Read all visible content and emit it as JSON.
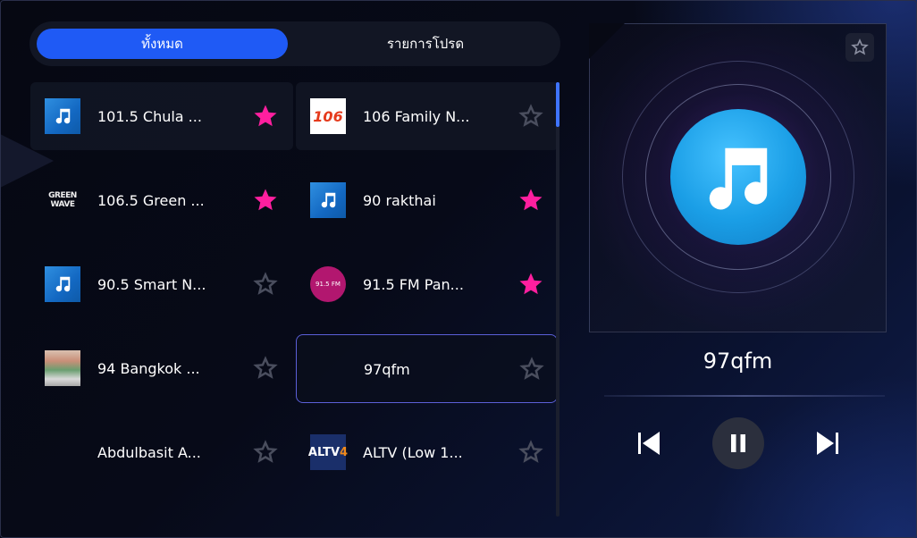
{
  "tabs": {
    "all_label": "ทั้งหมด",
    "favorites_label": "รายการโปรด"
  },
  "stations": [
    {
      "name": "101.5 Chula ...",
      "logo": "music-note",
      "favorite": true
    },
    {
      "name": "106 Family N...",
      "logo": "fm106",
      "favorite": false
    },
    {
      "name": "106.5 Green ...",
      "logo": "green-wave",
      "favorite": true
    },
    {
      "name": "90 rakthai",
      "logo": "music-note",
      "favorite": true
    },
    {
      "name": "90.5 Smart N...",
      "logo": "music-note",
      "favorite": false
    },
    {
      "name": "91.5 FM Pan...",
      "logo": "fm915",
      "favorite": true
    },
    {
      "name": "94 Bangkok ...",
      "logo": "image",
      "favorite": false
    },
    {
      "name": "97qfm",
      "logo": "none",
      "favorite": false
    },
    {
      "name": "Abdulbasit A...",
      "logo": "none",
      "favorite": false
    },
    {
      "name": "ALTV (Low 1...",
      "logo": "altv",
      "favorite": false
    }
  ],
  "logo_text": {
    "fm106": "106",
    "green_top": "GREEN",
    "green_bottom": "WAVE",
    "fm915": "91.5 FM",
    "altv_a": "ALTV",
    "altv_b": "4"
  },
  "now_playing": {
    "title": "97qfm",
    "favorite": false
  },
  "controls": {
    "previous": "skip-previous-icon",
    "pause": "pause-icon",
    "next": "skip-next-icon"
  },
  "colors": {
    "accent": "#1f5af5",
    "favorite": "#ff1f9f",
    "star_off": "#4a4e5e",
    "disc": "#1a9ee6"
  }
}
